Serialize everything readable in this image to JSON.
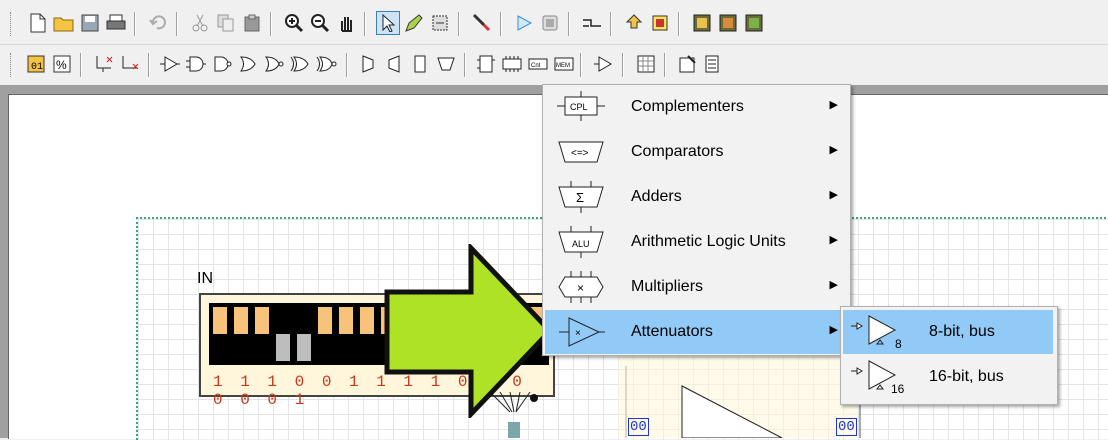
{
  "toolbar_top": {
    "buttons": [
      "new-icon",
      "open-folder-icon",
      "save-icon",
      "print-icon",
      "undo-icon",
      "cut-icon",
      "copy-icon",
      "paste-icon",
      "zoom-in-icon",
      "zoom-out-icon",
      "pan-hand-icon",
      "select-arrow-icon",
      "pencil-icon",
      "component-wand-icon",
      "probe-icon",
      "run-icon",
      "stop-icon",
      "wire-icon",
      "export-icon",
      "chip-icon",
      "chip-a-icon",
      "chip-b-icon",
      "chip-c-icon"
    ]
  },
  "toolbar_bottom": {
    "buttons": [
      "dip-switch-icon",
      "percent-icon",
      "ground-icon",
      "power-icon",
      "buffer-icon",
      "and-gate-icon",
      "nand-gate-icon",
      "or-gate-icon",
      "nor-gate-icon",
      "xor-gate-icon",
      "xnor-gate-icon",
      "mux-icon",
      "demux-icon",
      "decoder-icon",
      "encoder-icon",
      "flip-flop-icon",
      "counter-icon",
      "register-icon",
      "memory-icon",
      "attenuator-icon",
      "keypad-icon",
      "properties-icon",
      "display-icon"
    ]
  },
  "menu": {
    "items": [
      {
        "label": "Complementers",
        "icon": "complementer-icon",
        "icon_text": "CPL"
      },
      {
        "label": "Comparators",
        "icon": "comparator-icon",
        "icon_text": "<=>"
      },
      {
        "label": "Adders",
        "icon": "adder-icon",
        "icon_text": "Σ"
      },
      {
        "label": "Arithmetic Logic Units",
        "icon": "alu-icon",
        "icon_text": "ALU"
      },
      {
        "label": "Multipliers",
        "icon": "multiplier-icon",
        "icon_text": "×"
      },
      {
        "label": "Attenuators",
        "icon": "attenuator-icon",
        "icon_text": "×"
      }
    ],
    "highlighted": "Attenuators",
    "submenu_arrow": "▶"
  },
  "submenu": {
    "items": [
      {
        "label": "8-bit, bus",
        "icon": "attenuator-8-icon",
        "icon_text": "8"
      },
      {
        "label": "16-bit, bus",
        "icon": "attenuator-16-icon",
        "icon_text": "16"
      }
    ],
    "highlighted": "8-bit, bus"
  },
  "circuit": {
    "input_label": "IN",
    "bits": "1 1 1 0 0 1 1 1 1 0 1 0 0 0 0 1",
    "switch_states": [
      1,
      1,
      1,
      0,
      0,
      1,
      1,
      1,
      1,
      0,
      1,
      0,
      0,
      0,
      0,
      1
    ],
    "bus_tag_left": "00",
    "bus_tag_right": "00"
  },
  "colors": {
    "arrow_fill": "#aee224",
    "highlight": "#91c9f7",
    "switch_on": "#f7c27a",
    "switch_off_gray": "#bdbdbd",
    "bits_text": "#c8391a",
    "grid_border": "#3aa37f"
  }
}
